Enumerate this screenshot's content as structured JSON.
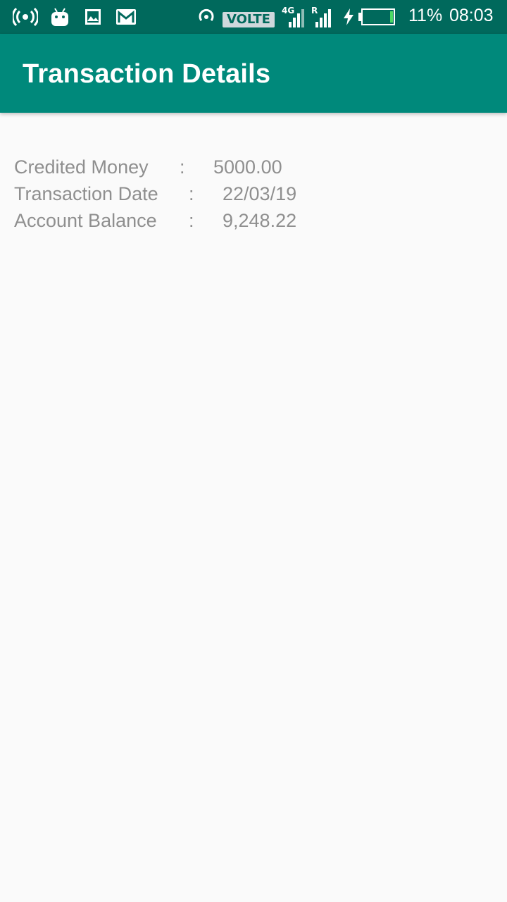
{
  "status_bar": {
    "network_label": "VOLTE 1",
    "net_4g": "4G",
    "roaming": "R",
    "battery_percent": "11%",
    "time": "08:03",
    "battery_level": 0.11,
    "battery_color": "#4cd964"
  },
  "app_bar": {
    "title": "Transaction Details",
    "color": "#00897b"
  },
  "details": [
    {
      "label": "Credited Money",
      "separator": ":",
      "value": "5000.00"
    },
    {
      "label": "Transaction Date",
      "separator": ":",
      "value": "22/03/19"
    },
    {
      "label": "Account Balance",
      "separator": ":",
      "value": "9,248.22"
    }
  ]
}
